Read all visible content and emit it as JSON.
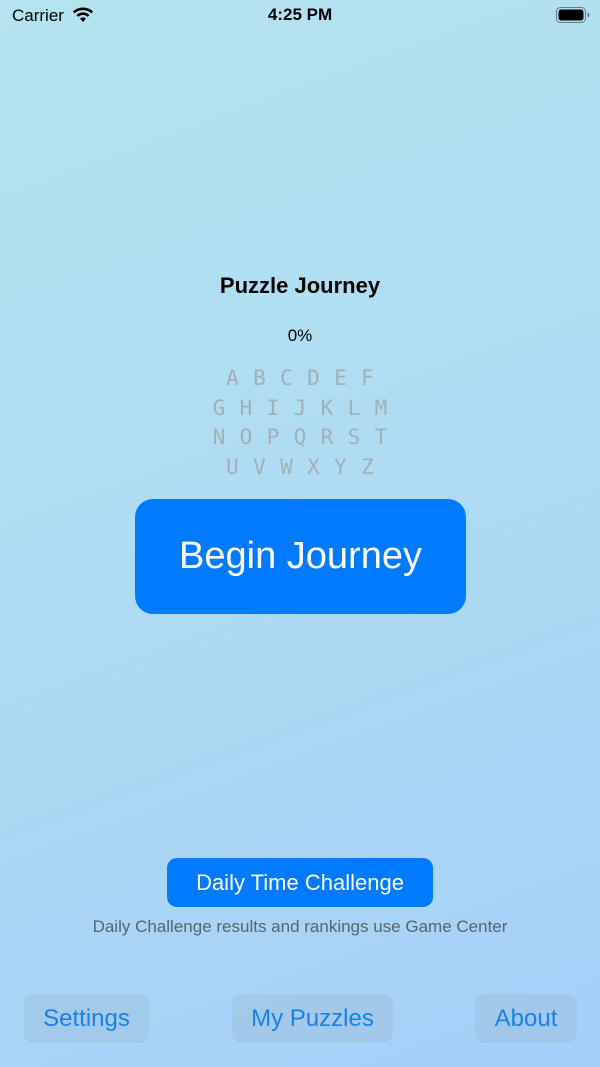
{
  "status_bar": {
    "carrier": "Carrier",
    "time": "4:25 PM"
  },
  "main": {
    "title": "Puzzle Journey",
    "progress": "0%",
    "letter_rows": [
      [
        "A",
        "B",
        "C",
        "D",
        "E",
        "F"
      ],
      [
        "G",
        "H",
        "I",
        "J",
        "K",
        "L",
        "M"
      ],
      [
        "N",
        "O",
        "P",
        "Q",
        "R",
        "S",
        "T"
      ],
      [
        "U",
        "V",
        "W",
        "X",
        "Y",
        "Z"
      ]
    ],
    "begin_label": "Begin Journey"
  },
  "daily": {
    "button_label": "Daily Time Challenge",
    "caption": "Daily Challenge results and rankings use Game Center"
  },
  "bottom_nav": {
    "settings_label": "Settings",
    "my_puzzles_label": "My Puzzles",
    "about_label": "About"
  },
  "colors": {
    "accent": "#007aff",
    "letter_color": "#9fb0b8"
  }
}
